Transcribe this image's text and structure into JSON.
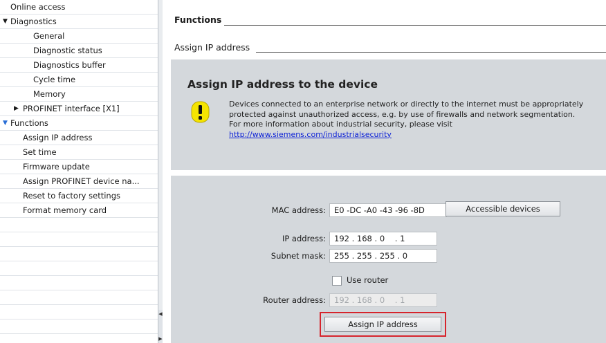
{
  "nav": {
    "items": [
      {
        "label": "Online access",
        "level": 0,
        "caret": ""
      },
      {
        "label": "Diagnostics",
        "level": 0,
        "caret": "down"
      },
      {
        "label": "General",
        "level": 2,
        "caret": ""
      },
      {
        "label": "Diagnostic status",
        "level": 2,
        "caret": ""
      },
      {
        "label": "Diagnostics buffer",
        "level": 2,
        "caret": ""
      },
      {
        "label": "Cycle time",
        "level": 2,
        "caret": ""
      },
      {
        "label": "Memory",
        "level": 2,
        "caret": ""
      },
      {
        "label": "PROFINET interface [X1]",
        "level": 1,
        "caret": "right"
      },
      {
        "label": "Functions",
        "level": 0,
        "caret": "down-blue"
      },
      {
        "label": "Assign IP address",
        "level": 1,
        "caret": ""
      },
      {
        "label": "Set time",
        "level": 1,
        "caret": ""
      },
      {
        "label": "Firmware update",
        "level": 1,
        "caret": ""
      },
      {
        "label": "Assign PROFINET device na...",
        "level": 1,
        "caret": ""
      },
      {
        "label": "Reset to factory settings",
        "level": 1,
        "caret": ""
      },
      {
        "label": "Format memory card",
        "level": 1,
        "caret": ""
      }
    ],
    "empty_rows": 8
  },
  "content": {
    "section_title": "Functions",
    "sub_title": "Assign IP address",
    "info": {
      "heading": "Assign IP address to the device",
      "warning_lines": [
        "Devices connected to an enterprise network or directly to the internet must be appropriately",
        "protected against unauthorized access, e.g. by use of firewalls and network segmentation.",
        "For more information about industrial security, please visit"
      ],
      "link": "http://www.siemens.com/industrialsecurity"
    },
    "form": {
      "mac_label": "MAC address:",
      "mac_value": "E0 -DC -A0 -43 -96 -8D",
      "accessible_button": "Accessible devices",
      "ip_label": "IP address:",
      "ip_value": "192 . 168 . 0    . 1",
      "subnet_label": "Subnet mask:",
      "subnet_value": "255 . 255 . 255 . 0",
      "use_router_label": "Use router",
      "use_router_checked": false,
      "router_label": "Router address:",
      "router_value": "192 . 168 . 0    . 1",
      "assign_button": "Assign IP address"
    }
  },
  "colors": {
    "panel": "#d4d8dc",
    "highlight": "#d6242c",
    "link": "#0a1fd6",
    "warning": "#f5e400"
  }
}
